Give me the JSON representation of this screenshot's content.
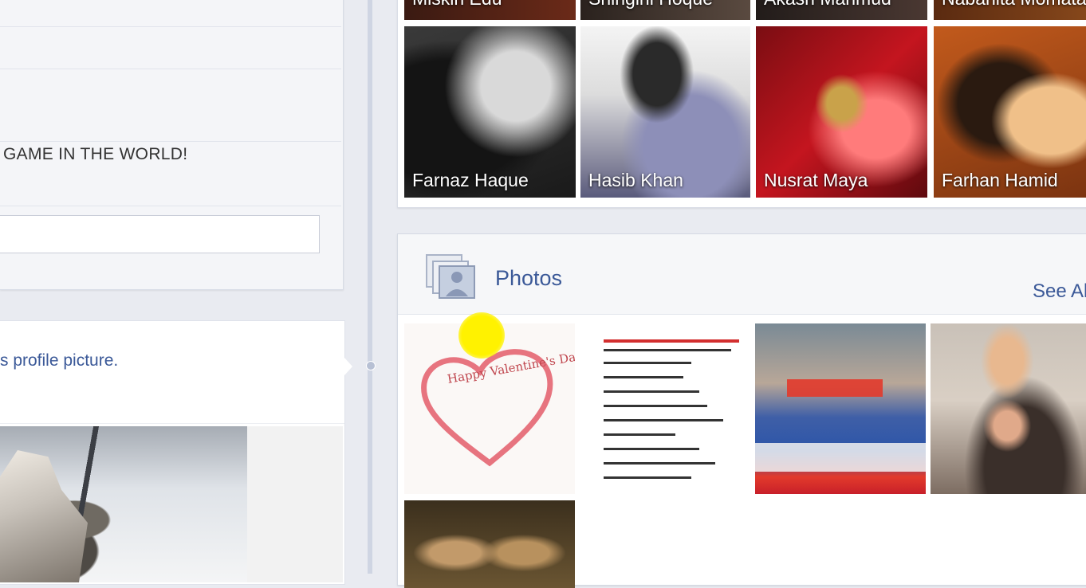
{
  "profile_info": {
    "info_text": "GAME IN THE WORLD!",
    "comment_placeholder": ""
  },
  "story": {
    "text": "s profile picture."
  },
  "friends": {
    "top_row": [
      "Miskin Edu",
      "Shingini Hoque",
      "Akash Mahmud",
      "Nabanita Momata"
    ],
    "tiles": [
      {
        "name": "Farnaz Haque"
      },
      {
        "name": "Hasib Khan"
      },
      {
        "name": "Nusrat Maya"
      },
      {
        "name": "Farhan Hamid"
      }
    ]
  },
  "photos": {
    "title": "Photos",
    "see_all": "See All",
    "header_icon": "photos-icon",
    "items": [
      {
        "caption": "Happy Valentine's Day!"
      },
      {
        "caption": ""
      },
      {
        "caption": ""
      },
      {
        "caption": ""
      },
      {
        "caption": ""
      }
    ]
  },
  "colors": {
    "link_blue": "#3b5998",
    "background": "#e9ebf1",
    "cursor_highlight": "#fff200"
  }
}
